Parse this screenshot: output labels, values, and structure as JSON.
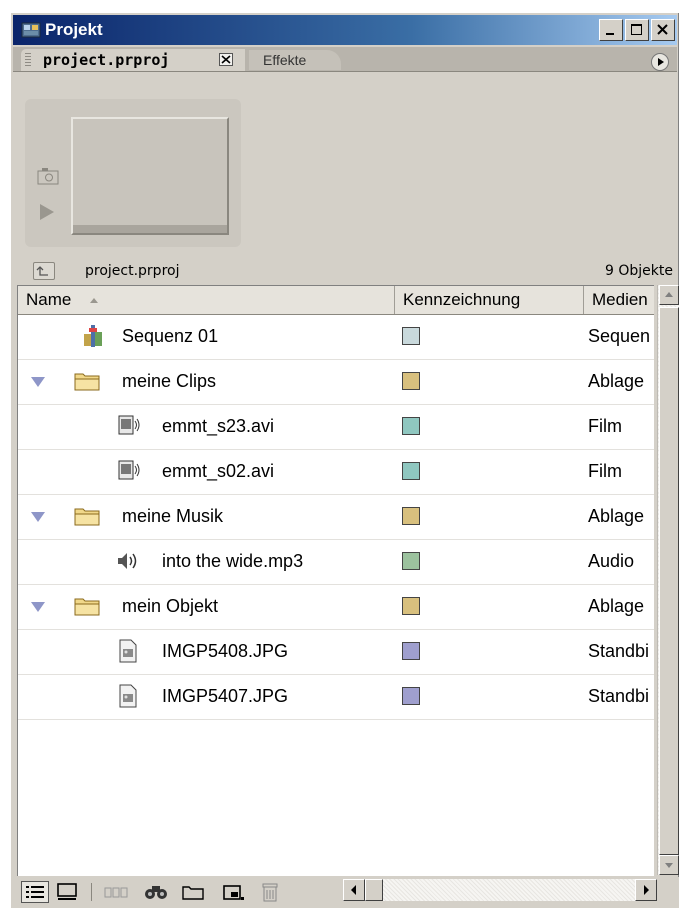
{
  "window": {
    "title": "Projekt"
  },
  "tabs": [
    {
      "label": "project.prproj",
      "active": true
    },
    {
      "label": "Effekte",
      "active": false
    }
  ],
  "path": {
    "name": "project.prproj",
    "count": "9 Objekte"
  },
  "columns": {
    "name": "Name",
    "label": "Kennzeichnung",
    "media": "Medien"
  },
  "items": [
    {
      "name": "Sequenz 01",
      "media": "Sequen",
      "color": "#c9d9dc",
      "type": "sequence-icon"
    },
    {
      "name": "meine Clips",
      "media": "Ablage",
      "color": "#d8c07e",
      "type": "folder-icon",
      "expanded": true
    },
    {
      "name": "emmt_s23.avi",
      "media": "Film",
      "color": "#8fc7c0",
      "type": "movie-icon"
    },
    {
      "name": "emmt_s02.avi",
      "media": "Film",
      "color": "#8fc7c0",
      "type": "movie-icon"
    },
    {
      "name": "meine Musik",
      "media": "Ablage",
      "color": "#d8c07e",
      "type": "folder-icon",
      "expanded": true
    },
    {
      "name": "into the wide.mp3",
      "media": "Audio",
      "color": "#9cc29e",
      "type": "audio-icon"
    },
    {
      "name": "mein Objekt",
      "media": "Ablage",
      "color": "#d8c07e",
      "type": "folder-icon",
      "expanded": true
    },
    {
      "name": "IMGP5408.JPG",
      "media": "Standbi",
      "color": "#9f9fce",
      "type": "image-icon"
    },
    {
      "name": "IMGP5407.JPG",
      "media": "Standbi",
      "color": "#9f9fce",
      "type": "image-icon"
    }
  ]
}
